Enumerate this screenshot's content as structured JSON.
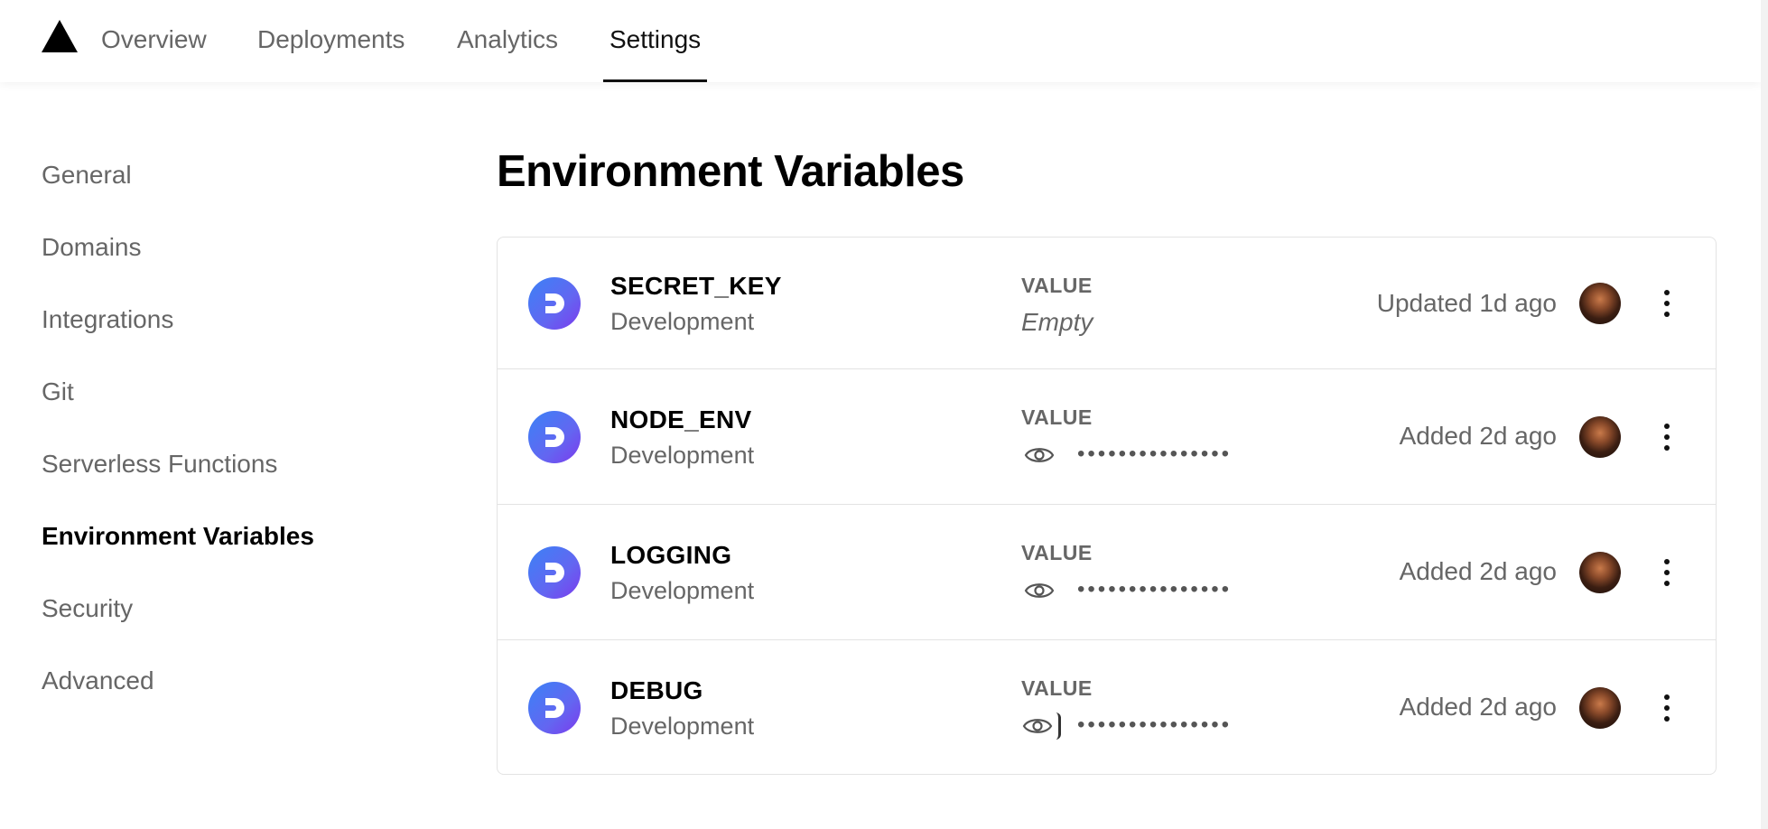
{
  "nav": {
    "tabs": [
      {
        "label": "Overview"
      },
      {
        "label": "Deployments"
      },
      {
        "label": "Analytics"
      },
      {
        "label": "Settings"
      }
    ],
    "active_tab": "Settings"
  },
  "sidebar": {
    "items": [
      {
        "label": "General"
      },
      {
        "label": "Domains"
      },
      {
        "label": "Integrations"
      },
      {
        "label": "Git"
      },
      {
        "label": "Serverless Functions"
      },
      {
        "label": "Environment Variables"
      },
      {
        "label": "Security"
      },
      {
        "label": "Advanced"
      }
    ],
    "active_item": "Environment Variables"
  },
  "main": {
    "title": "Environment Variables",
    "variables": [
      {
        "name": "SECRET_KEY",
        "environment": "Development",
        "value_label": "VALUE",
        "value_text": "Empty",
        "value_hidden": false,
        "timestamp": "Updated 1d ago"
      },
      {
        "name": "NODE_ENV",
        "environment": "Development",
        "value_label": "VALUE",
        "masked": "•••••••••••••••",
        "value_hidden": true,
        "timestamp": "Added 2d ago"
      },
      {
        "name": "LOGGING",
        "environment": "Development",
        "value_label": "VALUE",
        "masked": "•••••••••••••••",
        "value_hidden": true,
        "timestamp": "Added 2d ago"
      },
      {
        "name": "DEBUG",
        "environment": "Development",
        "value_label": "VALUE",
        "masked": "•••••••••••••••",
        "value_hidden": true,
        "timestamp": "Added 2d ago"
      }
    ]
  },
  "icons": {
    "logo": "triangle-logo-icon",
    "app": "app-logo-icon",
    "reveal": "eye-icon",
    "menu": "more-vertical-icon"
  },
  "colors": {
    "accent_gradient_start": "#3b82f6",
    "accent_gradient_end": "#7c3aed",
    "text_primary": "#111111",
    "text_secondary": "#666666",
    "border": "#e3e3e3"
  }
}
